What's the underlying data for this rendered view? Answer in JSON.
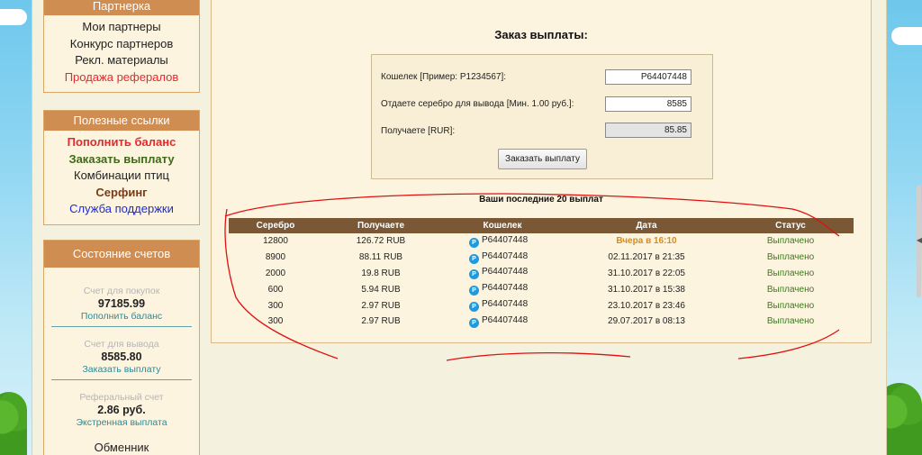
{
  "sidebar": {
    "partners": {
      "title": "Партнерка",
      "items": [
        {
          "label": "Мои партнеры"
        },
        {
          "label": "Конкурс партнеров"
        },
        {
          "label": "Рекл. материалы"
        },
        {
          "label": "Продажа рефералов"
        }
      ]
    },
    "useful": {
      "title": "Полезные ссылки",
      "items": [
        {
          "label": "Пополнить баланс"
        },
        {
          "label": "Заказать выплату"
        },
        {
          "label": "Комбинации птиц"
        },
        {
          "label": "Серфинг"
        },
        {
          "label": "Служба поддержки"
        }
      ]
    },
    "accounts": {
      "title": "Состояние счетов",
      "blocks": [
        {
          "label": "Счет для покупок",
          "value": "97185.99",
          "action": "Пополнить баланс"
        },
        {
          "label": "Счет для вывода",
          "value": "8585.80",
          "action": "Заказать выплату"
        },
        {
          "label": "Реферальный счет",
          "value": "2.86 руб.",
          "action": "Экстренная выплата"
        }
      ],
      "exchanger": "Обменник"
    }
  },
  "main": {
    "title": "Заказ выплаты:",
    "form": {
      "wallet_label": "Кошелек [Пример: P1234567]:",
      "wallet_value": "P64407448",
      "silver_label": "Отдаете серебро для вывода [Мин. 1.00 руб.]:",
      "silver_value": "8585",
      "receive_label": "Получаете [RUR]:",
      "receive_value": "85.85",
      "submit_label": "Заказать выплату"
    },
    "table": {
      "caption": "Ваши последние 20 выплат",
      "headers": [
        "Серебро",
        "Получаете",
        "Кошелек",
        "Дата",
        "Статус"
      ],
      "wallet_icon": "P",
      "rows": [
        {
          "silver": "12800",
          "receive": "126.72 RUB",
          "wallet": "P64407448",
          "date": "Вчера в 16:10",
          "status": "Выплачено"
        },
        {
          "silver": "8900",
          "receive": "88.11 RUB",
          "wallet": "P64407448",
          "date": "02.11.2017 в 21:35",
          "status": "Выплачено"
        },
        {
          "silver": "2000",
          "receive": "19.8 RUB",
          "wallet": "P64407448",
          "date": "31.10.2017 в 22:05",
          "status": "Выплачено"
        },
        {
          "silver": "600",
          "receive": "5.94 RUB",
          "wallet": "P64407448",
          "date": "31.10.2017 в 15:38",
          "status": "Выплачено"
        },
        {
          "silver": "300",
          "receive": "2.97 RUB",
          "wallet": "P64407448",
          "date": "23.10.2017 в 23:46",
          "status": "Выплачено"
        },
        {
          "silver": "300",
          "receive": "2.97 RUB",
          "wallet": "P64407448",
          "date": "29.07.2017 в 08:13",
          "status": "Выплачено"
        }
      ]
    }
  },
  "colors": {
    "accent": "#cf8d52",
    "table_header": "#7a5836",
    "status": "#3a7a1c",
    "today": "#d98a1a",
    "annotation": "#e01010"
  }
}
